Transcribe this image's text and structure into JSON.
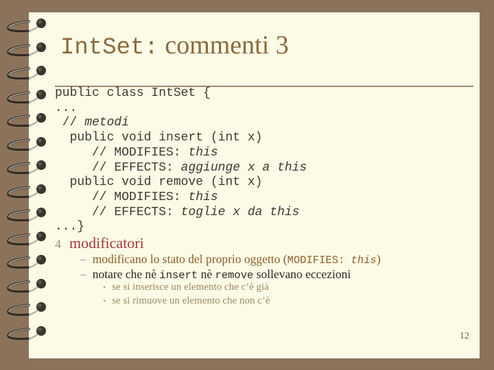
{
  "slide": {
    "title_code": "IntSet:",
    "title_text": " commenti 3",
    "code_lines": [
      [
        {
          "t": "public class IntSet {",
          "i": false
        }
      ],
      [
        {
          "t": "...",
          "i": false
        }
      ],
      [
        {
          "t": " // ",
          "i": false
        },
        {
          "t": "metodi",
          "i": true
        }
      ],
      [
        {
          "t": "  public void insert (int x)",
          "i": false
        }
      ],
      [
        {
          "t": "     // MODIFIES: ",
          "i": false
        },
        {
          "t": "this",
          "i": true
        }
      ],
      [
        {
          "t": "     // EFFECTS: ",
          "i": false
        },
        {
          "t": "aggiunge x a this",
          "i": true
        }
      ],
      [
        {
          "t": "  public void remove (int x)",
          "i": false
        }
      ],
      [
        {
          "t": "     // MODIFIES: ",
          "i": false
        },
        {
          "t": "this",
          "i": true
        }
      ],
      [
        {
          "t": "     // EFFECTS: ",
          "i": false
        },
        {
          "t": "toglie x da this",
          "i": true
        }
      ],
      [
        {
          "t": "...}",
          "i": false
        }
      ]
    ],
    "bullet_marker": "4",
    "bullet_text": "modificatori",
    "sub1": {
      "dash": "–",
      "text": "modificano lo stato del proprio oggetto (",
      "code": "MODIFIES: ",
      "code_italic": "this",
      "close": ")"
    },
    "sub2": {
      "dash": "–",
      "a": "notare che nè ",
      "code1": "insert",
      "b": " nè ",
      "code2": "remove",
      "c": " sollevano eccezioni"
    },
    "subsub": [
      {
        "dot": "•",
        "text": "se si inserisce un elemento che c’è già"
      },
      {
        "dot": "•",
        "text": "se si rimuove un elemento che non c’è"
      }
    ],
    "page_number": "12"
  }
}
